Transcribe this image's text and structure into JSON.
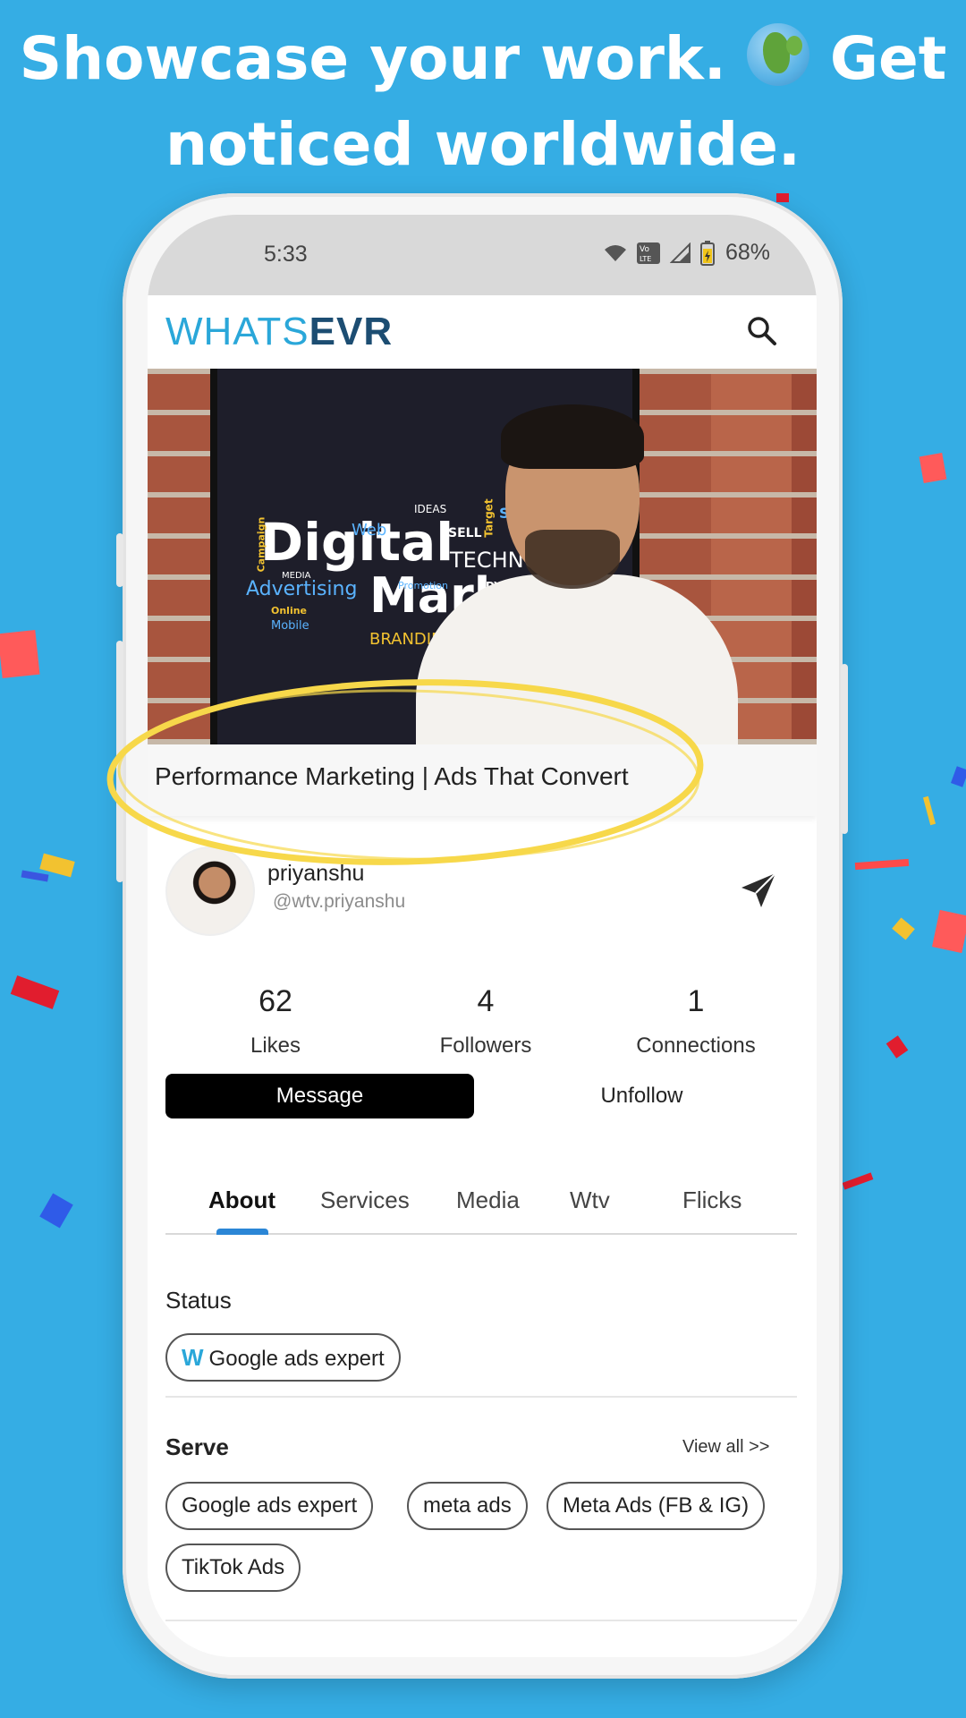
{
  "banner": {
    "line1_a": "Showcase your work.",
    "line1_b": "Get",
    "line2": "noticed worldwide.",
    "globe_icon": "globe-icon"
  },
  "status_bar": {
    "time": "5:33",
    "battery": "68%",
    "icons": [
      "wifi-icon",
      "volte-icon",
      "signal-icon",
      "battery-icon"
    ]
  },
  "app_bar": {
    "logo_part1": "WHATS",
    "logo_part2": "EVR",
    "search_icon": "search-icon"
  },
  "cover": {
    "title": "Performance Marketing | Ads That Convert",
    "board_words": [
      "Digital",
      "Marketing",
      "Advertising",
      "TECHNOLOGY",
      "BRANDING",
      "Web",
      "SELL",
      "IDEAS",
      "Mobile",
      "Online",
      "DYNAMIC",
      "Campaign",
      "MEDIA",
      "Promotion",
      "SEO",
      "Target"
    ]
  },
  "profile": {
    "name": "priyanshu",
    "handle": "@wtv.priyanshu"
  },
  "stats": [
    {
      "value": "62",
      "label": "Likes"
    },
    {
      "value": "4",
      "label": "Followers"
    },
    {
      "value": "1",
      "label": "Connections"
    }
  ],
  "actions": {
    "message": "Message",
    "unfollow": "Unfollow"
  },
  "tabs": [
    {
      "label": "About",
      "active": true
    },
    {
      "label": "Services",
      "active": false
    },
    {
      "label": "Media",
      "active": false
    },
    {
      "label": "Wtv",
      "active": false
    },
    {
      "label": "Flicks",
      "active": false
    }
  ],
  "status_section": {
    "title": "Status",
    "chip": "Google ads expert",
    "chip_icon": "W"
  },
  "serve_section": {
    "title": "Serve",
    "view_all": "View all >>",
    "chips": [
      "Google ads expert",
      "meta ads",
      "Meta Ads (FB & IG)",
      "TikTok Ads"
    ]
  },
  "colors": {
    "background": "#35ADE4",
    "brand_light": "#2aa7d9",
    "brand_dark": "#1c4d72",
    "tab_indicator": "#2b86d6",
    "highlight_ring": "#F7D84A"
  }
}
